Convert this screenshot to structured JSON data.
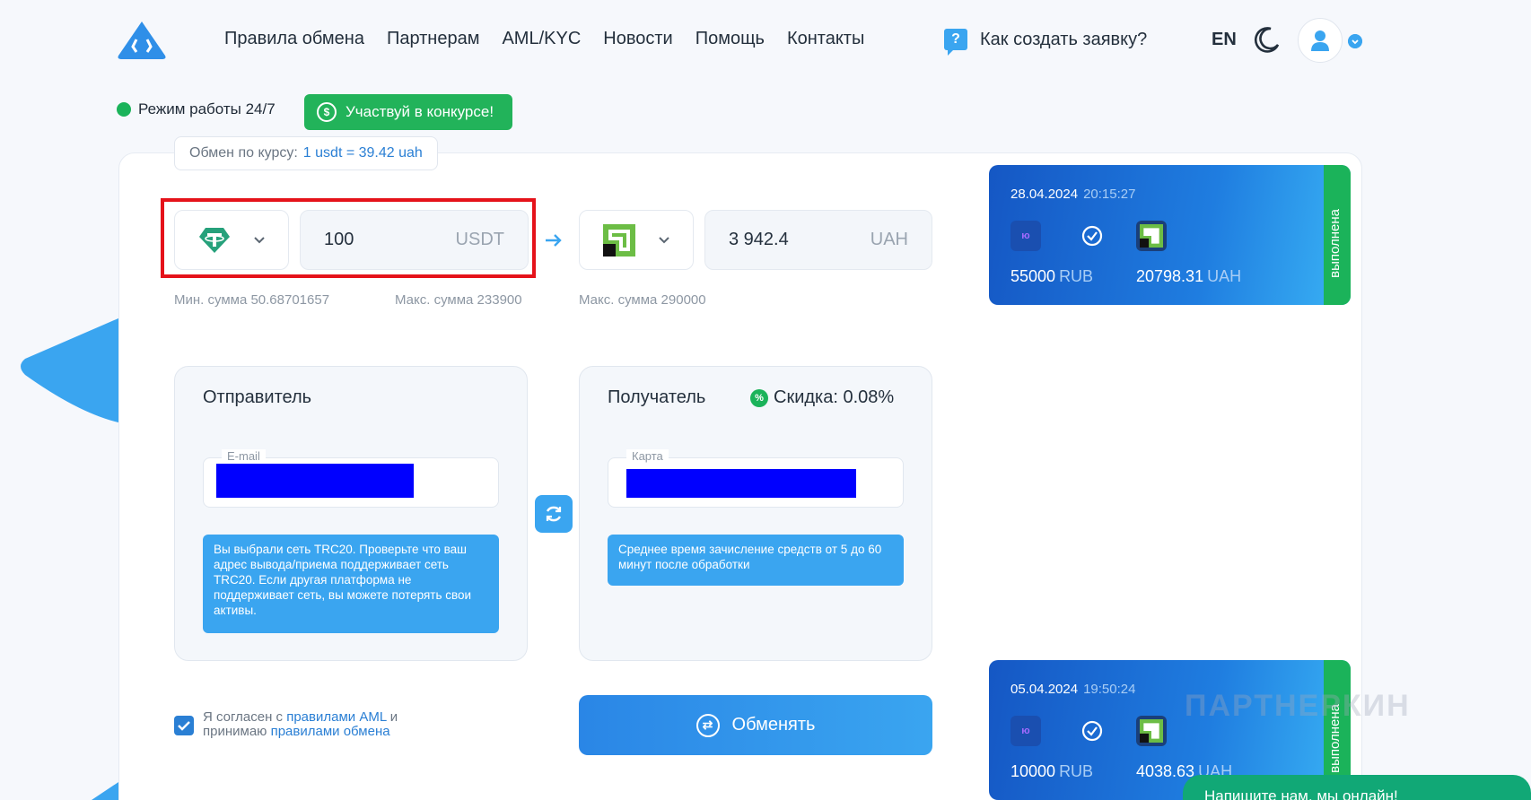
{
  "header": {
    "nav": [
      "Правила обмена",
      "Партнерам",
      "AML/KYC",
      "Новости",
      "Помощь",
      "Контакты"
    ],
    "howto": "Как создать заявку?",
    "lang": "EN"
  },
  "status": {
    "mode": "Режим работы 24/7",
    "contest": "Участвуй в конкурсе!"
  },
  "rate": {
    "label": "Обмен по курсу:",
    "value": "1 usdt = 39.42 uah"
  },
  "give": {
    "amount": "100",
    "currency": "USDT",
    "min": "Мин. сумма 50.68701657",
    "max": "Макс. сумма 233900"
  },
  "get": {
    "amount": "3 942.4",
    "currency": "UAH",
    "max": "Макс. сумма 290000"
  },
  "sender": {
    "title": "Отправитель",
    "email_label": "E-mail",
    "note": "Вы выбрали сеть TRC20. Проверьте что ваш адрес вывода/приема поддерживает сеть TRC20. Если другая платформа не поддерживает сеть, вы можете потерять свои активы."
  },
  "receiver": {
    "title": "Получатель",
    "discount": "Скидка: 0.08%",
    "card_label": "Карта",
    "note": "Среднее время зачисление средств от 5 до 60 минут после обработки"
  },
  "agree": {
    "text1": "Я согласен с ",
    "link1": "правилами AML",
    "text2": " и принимаю ",
    "link2": "правилами обмена"
  },
  "exchange_button": "Обменять",
  "transactions": [
    {
      "date": "28.04.2024",
      "time": "20:15:27",
      "from_amount": "55000",
      "from_cur": "RUB",
      "to_amount": "20798.31",
      "to_cur": "UAH",
      "status": "выполнена"
    },
    {
      "date": "05.04.2024",
      "time": "19:50:24",
      "from_amount": "10000",
      "from_cur": "RUB",
      "to_amount": "4038.63",
      "to_cur": "UAH",
      "status": "выполнена"
    }
  ],
  "watermark": "ПАРТНЕРКИН",
  "chat": "Напишите нам, мы онлайн!",
  "colors": {
    "accent": "#3aa5f0",
    "green": "#1bb35a",
    "highlight": "#e5121a"
  }
}
